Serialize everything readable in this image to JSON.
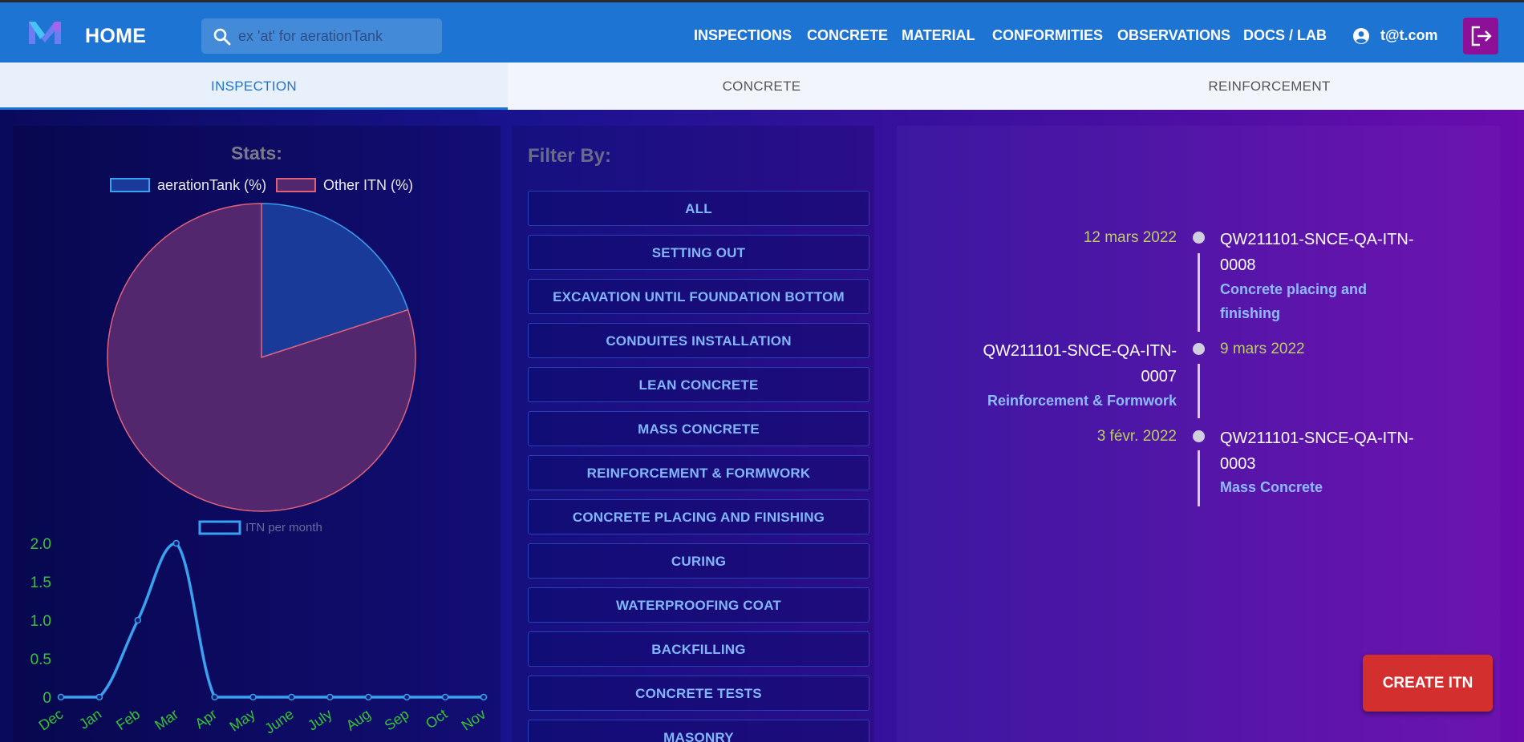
{
  "header": {
    "title": "HOME",
    "search_placeholder": "ex 'at' for aerationTank",
    "nav": [
      "INSPECTIONS",
      "CONCRETE",
      "MATERIAL",
      "CONFORMITIES",
      "OBSERVATIONS",
      "DOCS / LAB"
    ],
    "user": "t@t.com"
  },
  "tabs": [
    "INSPECTION",
    "CONCRETE",
    "REINFORCEMENT"
  ],
  "stats": {
    "title": "Stats:",
    "legend": [
      "aerationTank (%)",
      "Other ITN (%)"
    ]
  },
  "filter": {
    "title": "Filter By:",
    "buttons": [
      "ALL",
      "SETTING OUT",
      "EXCAVATION UNTIL FOUNDATION BOTTOM",
      "CONDUITES INSTALLATION",
      "LEAN CONCRETE",
      "MASS CONCRETE",
      "REINFORCEMENT & FORMWORK",
      "CONCRETE PLACING AND FINISHING",
      "CURING",
      "WATERPROOFING COAT",
      "BACKFILLING",
      "CONCRETE TESTS",
      "MASONRY"
    ]
  },
  "timeline": [
    {
      "date": "12 mars 2022",
      "code": "QW211101-SNCE-QA-ITN-0008",
      "desc": "Concrete placing and finishing"
    },
    {
      "date": "9 mars 2022",
      "code": "QW211101-SNCE-QA-ITN-0007",
      "desc": "Reinforcement & Formwork"
    },
    {
      "date": "3 févr. 2022",
      "code": "QW211101-SNCE-QA-ITN-0003",
      "desc": "Mass Concrete"
    }
  ],
  "create_button": "CREATE ITN",
  "colors": {
    "accent": "#1e74d2",
    "pie_a": "#1a3a9a",
    "pie_b": "#52276e",
    "line": "#3aa0f0",
    "tick": "#34c534",
    "create": "#d32f2f"
  },
  "chart_data": [
    {
      "type": "pie",
      "labels": [
        "aerationTank (%)",
        "Other ITN (%)"
      ],
      "values": [
        20,
        80
      ]
    },
    {
      "type": "line",
      "series": [
        {
          "name": "ITN per month",
          "values": [
            0,
            0,
            1,
            2,
            0,
            0,
            0,
            0,
            0,
            0,
            0,
            0
          ]
        }
      ],
      "categories": [
        "Dec",
        "Jan",
        "Feb",
        "Mar",
        "Apr",
        "May",
        "June",
        "July",
        "Aug",
        "Sep",
        "Oct",
        "Nov"
      ],
      "ylim": [
        0,
        2
      ],
      "yticks": [
        "0",
        "0.5",
        "1.0",
        "1.5",
        "2.0"
      ],
      "grid": false
    }
  ]
}
